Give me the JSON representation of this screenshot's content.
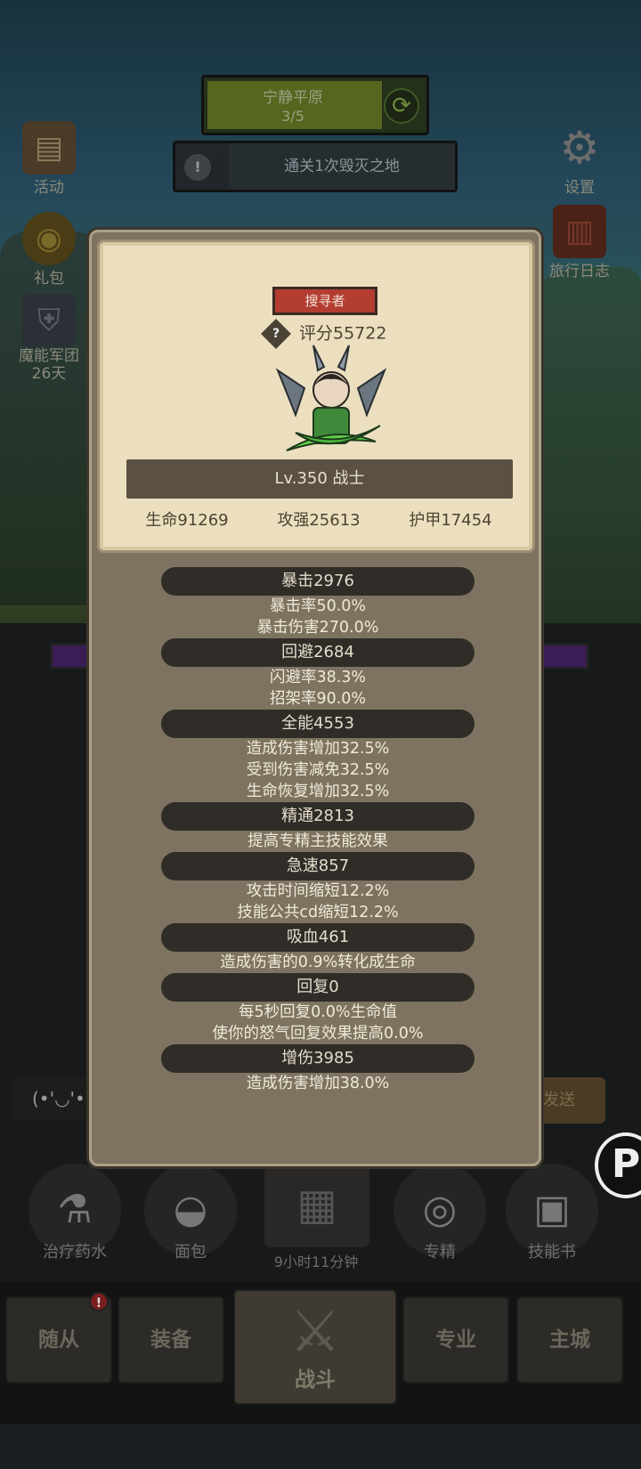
{
  "stage": {
    "name": "宁静平原",
    "progress": "3/5"
  },
  "quest": {
    "text": "通关1次毁灭之地"
  },
  "left_menu": [
    {
      "label": "活动",
      "icon": "book-icon"
    },
    {
      "label": "礼包",
      "icon": "gift-icon"
    },
    {
      "label": "魔能军团\n26天",
      "icon": "helmet-icon"
    }
  ],
  "right_menu": [
    {
      "label": "设置",
      "icon": "gear-icon"
    },
    {
      "label": "旅行日志",
      "icon": "journal-icon"
    }
  ],
  "hero_card": {
    "tag": "搜寻者",
    "score": "评分55722",
    "level_class": "Lv.350 战士",
    "hp": "生命91269",
    "attack": "攻强25613",
    "armor": "护甲17454"
  },
  "stats": [
    {
      "header": "暴击2976",
      "lines": [
        "暴击率50.0%",
        "暴击伤害270.0%"
      ]
    },
    {
      "header": "回避2684",
      "lines": [
        "闪避率38.3%",
        "招架率90.0%"
      ]
    },
    {
      "header": "全能4553",
      "lines": [
        "造成伤害增加32.5%",
        "受到伤害减免32.5%",
        "生命恢复增加32.5%"
      ]
    },
    {
      "header": "精通2813",
      "lines": [
        "提高专精主技能效果"
      ]
    },
    {
      "header": "急速857",
      "lines": [
        "攻击时间缩短12.2%",
        "技能公共cd缩短12.2%"
      ]
    },
    {
      "header": "吸血461",
      "lines": [
        "造成伤害的0.9%转化成生命"
      ]
    },
    {
      "header": "回复0",
      "lines": [
        "每5秒回复0.0%生命值",
        "使你的怒气回复效果提高0.0%"
      ]
    },
    {
      "header": "增伤3985",
      "lines": [
        "造成伤害增加38.0%"
      ]
    }
  ],
  "items": [
    {
      "label": "治疗药水",
      "icon": "potion-icon"
    },
    {
      "label": "面包",
      "icon": "bread-icon"
    },
    {
      "label": "专精",
      "icon": "specialization-icon"
    },
    {
      "label": "技能书",
      "icon": "skillbook-icon"
    }
  ],
  "chest_timer": "9小时11分钟",
  "nav": {
    "tabs": [
      "随从",
      "装备",
      "战斗",
      "专业",
      "主城"
    ],
    "badge": "!"
  },
  "chat_hint": "(•'◡'•",
  "send_label": "发送"
}
